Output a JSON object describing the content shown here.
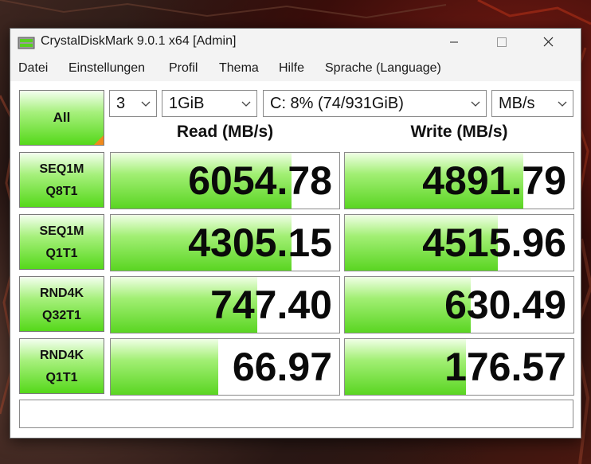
{
  "window": {
    "title": "CrystalDiskMark 9.0.1 x64 [Admin]"
  },
  "menu": [
    "Datei",
    "Einstellungen",
    "Profil",
    "Thema",
    "Hilfe",
    "Sprache (Language)"
  ],
  "controls": {
    "all_label": "All",
    "count": "3",
    "size": "1GiB",
    "drive": "C: 8% (74/931GiB)",
    "unit": "MB/s"
  },
  "headers": {
    "read": "Read (MB/s)",
    "write": "Write (MB/s)"
  },
  "tests": [
    {
      "line1": "SEQ1M",
      "line2": "Q8T1",
      "read": "6054.78",
      "write": "4891.79",
      "read_fill": 0.79,
      "write_fill": 0.78
    },
    {
      "line1": "SEQ1M",
      "line2": "Q1T1",
      "read": "4305.15",
      "write": "4515.96",
      "read_fill": 0.79,
      "write_fill": 0.67
    },
    {
      "line1": "RND4K",
      "line2": "Q32T1",
      "read": "747.40",
      "write": "630.49",
      "read_fill": 0.64,
      "write_fill": 0.55
    },
    {
      "line1": "RND4K",
      "line2": "Q1T1",
      "read": "66.97",
      "write": "176.57",
      "read_fill": 0.47,
      "write_fill": 0.53
    }
  ],
  "status": "",
  "colors": {
    "green_accent": "#55d81a",
    "corner_mark": "#f08a1c"
  }
}
